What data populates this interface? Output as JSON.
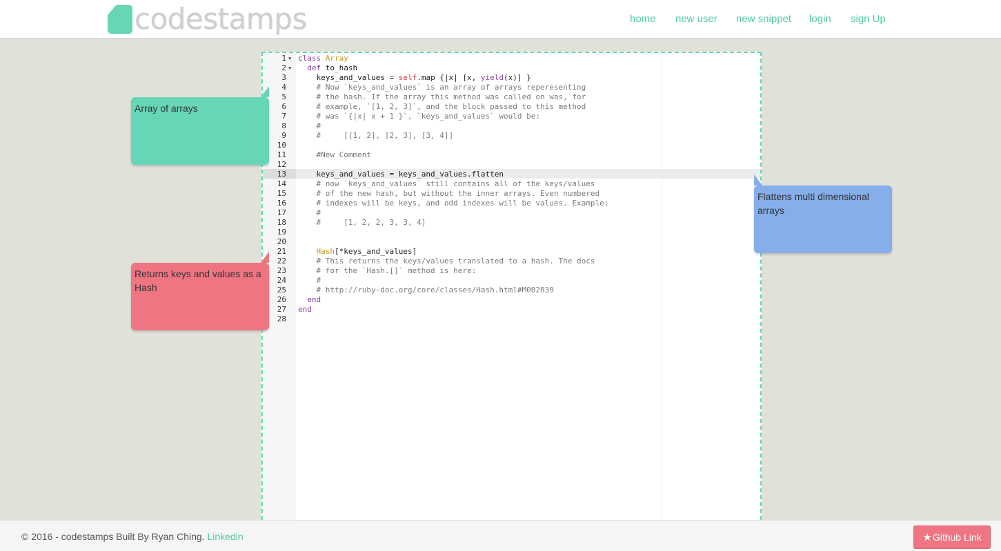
{
  "brand": {
    "logo_text": "codestamps",
    "accent": "#66d6b6"
  },
  "nav": {
    "home": "home",
    "new_user": "new user",
    "new_snippet": "new snippet",
    "login": "login",
    "sign_up": "sign Up"
  },
  "editor": {
    "active_line": 13,
    "lines": [
      {
        "n": "1",
        "fold": true,
        "segs": [
          [
            "kw",
            "class "
          ],
          [
            "cls",
            "Array"
          ]
        ]
      },
      {
        "n": "2",
        "fold": true,
        "segs": [
          [
            "",
            "  "
          ],
          [
            "kw",
            "def "
          ],
          [
            "",
            "to_hash"
          ]
        ]
      },
      {
        "n": "3",
        "fold": false,
        "segs": [
          [
            "",
            "    keys_and_values = "
          ],
          [
            "self",
            "self"
          ],
          [
            "",
            ".map {|x| [x, "
          ],
          [
            "kw",
            "yield"
          ],
          [
            "",
            "(x)] }"
          ]
        ]
      },
      {
        "n": "4",
        "fold": false,
        "segs": [
          [
            "cmt",
            "    # Now `keys_and_values` is an array of arrays reperesenting"
          ]
        ]
      },
      {
        "n": "5",
        "fold": false,
        "segs": [
          [
            "cmt",
            "    # the hash. If the array this method was called on was, for"
          ]
        ]
      },
      {
        "n": "6",
        "fold": false,
        "segs": [
          [
            "cmt",
            "    # example, `[1, 2, 3]`, and the block passed to this method"
          ]
        ]
      },
      {
        "n": "7",
        "fold": false,
        "segs": [
          [
            "cmt",
            "    # was `{|x| x + 1 }`, `keys_and_values` would be:"
          ]
        ]
      },
      {
        "n": "8",
        "fold": false,
        "segs": [
          [
            "cmt",
            "    #"
          ]
        ]
      },
      {
        "n": "9",
        "fold": false,
        "segs": [
          [
            "cmt",
            "    #     [[1, 2], [2, 3], [3, 4]]"
          ]
        ]
      },
      {
        "n": "10",
        "fold": false,
        "segs": []
      },
      {
        "n": "11",
        "fold": false,
        "segs": [
          [
            "cmt",
            "    #New Comment"
          ]
        ]
      },
      {
        "n": "12",
        "fold": false,
        "segs": []
      },
      {
        "n": "13",
        "fold": false,
        "segs": [
          [
            "",
            "    keys_and_values = keys_and_values.flatten"
          ]
        ]
      },
      {
        "n": "14",
        "fold": false,
        "segs": [
          [
            "cmt",
            "    # now `keys_and_values` still contains all of the keys/values"
          ]
        ]
      },
      {
        "n": "15",
        "fold": false,
        "segs": [
          [
            "cmt",
            "    # of the new hash, but without the inner arrays. Even numbered"
          ]
        ]
      },
      {
        "n": "16",
        "fold": false,
        "segs": [
          [
            "cmt",
            "    # indexes will be keys, and odd indexes will be values. Example:"
          ]
        ]
      },
      {
        "n": "17",
        "fold": false,
        "segs": [
          [
            "cmt",
            "    #"
          ]
        ]
      },
      {
        "n": "18",
        "fold": false,
        "segs": [
          [
            "cmt",
            "    #     [1, 2, 2, 3, 3, 4]"
          ]
        ]
      },
      {
        "n": "19",
        "fold": false,
        "segs": []
      },
      {
        "n": "20",
        "fold": false,
        "segs": []
      },
      {
        "n": "21",
        "fold": false,
        "segs": [
          [
            "",
            "    "
          ],
          [
            "cls",
            "Hash"
          ],
          [
            "",
            "[*keys_and_values]"
          ]
        ]
      },
      {
        "n": "22",
        "fold": false,
        "segs": [
          [
            "cmt",
            "    # This returns the keys/values translated to a hash. The docs"
          ]
        ]
      },
      {
        "n": "23",
        "fold": false,
        "segs": [
          [
            "cmt",
            "    # for the `Hash.[]` method is here:"
          ]
        ]
      },
      {
        "n": "24",
        "fold": false,
        "segs": [
          [
            "cmt",
            "    #"
          ]
        ]
      },
      {
        "n": "25",
        "fold": false,
        "segs": [
          [
            "cmt",
            "    # http://ruby-doc.org/core/classes/Hash.html#M002839"
          ]
        ]
      },
      {
        "n": "26",
        "fold": false,
        "segs": [
          [
            "kw",
            "  end"
          ]
        ]
      },
      {
        "n": "27",
        "fold": false,
        "segs": [
          [
            "kw",
            "end"
          ]
        ]
      },
      {
        "n": "28",
        "fold": false,
        "segs": []
      }
    ]
  },
  "stamps": {
    "array_of_arrays": {
      "text": "Array of arrays",
      "color": "#66d6b6"
    },
    "flattens": {
      "text": "Flattens multi dimensional arrays",
      "color": "#85aeea"
    },
    "returns_hash": {
      "text": "Returns keys and values as a Hash",
      "color": "#ef7582"
    }
  },
  "footer": {
    "copyright": "© 2016 - codestamps Built By Ryan Ching.",
    "linkedin": "Linkedin",
    "github": "Github Link",
    "github_color": "#ef7582"
  }
}
